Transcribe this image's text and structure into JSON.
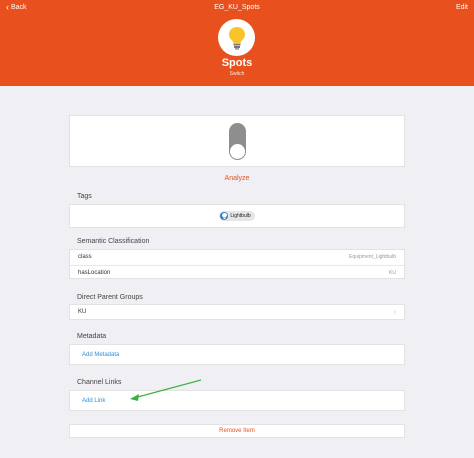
{
  "nav": {
    "back_label": "Back",
    "title": "EG_KU_Spots",
    "edit_label": "Edit"
  },
  "item": {
    "name": "Spots",
    "type": "Switch",
    "icon": "lightbulb-icon"
  },
  "analyze_label": "Analyze",
  "tags": {
    "title": "Tags",
    "items": [
      {
        "label": "Lightbulb",
        "icon": "lightbulb-icon"
      }
    ]
  },
  "semantic": {
    "title": "Semantic Classification",
    "rows": [
      {
        "key": "class",
        "value": "Equipment_Lightbulb"
      },
      {
        "key": "hasLocation",
        "value": "KU"
      }
    ]
  },
  "groups": {
    "title": "Direct Parent Groups",
    "items": [
      {
        "label": "KU"
      }
    ]
  },
  "metadata": {
    "title": "Metadata",
    "add_label": "Add Metadata"
  },
  "channels": {
    "title": "Channel Links",
    "add_label": "Add Link"
  },
  "remove_label": "Remove Item",
  "colors": {
    "accent": "#e8501d",
    "link": "#2f8fd8",
    "annotation": "#3cb043"
  }
}
